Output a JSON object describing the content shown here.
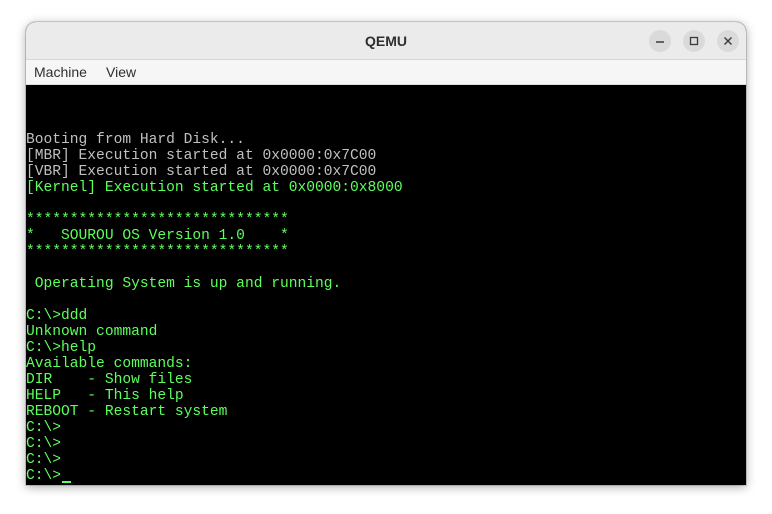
{
  "window": {
    "title": "QEMU"
  },
  "menubar": {
    "items": [
      {
        "label": "Machine"
      },
      {
        "label": "View"
      }
    ]
  },
  "colors": {
    "gray": "#c0c0c0",
    "green": "#5cff5c",
    "background": "#000000"
  },
  "console": {
    "lines": [
      {
        "text": "Booting from Hard Disk...",
        "color": "gray",
        "row": 0
      },
      {
        "text": "[MBR] Execution started at 0x0000:0x7C00",
        "color": "gray",
        "row": 1
      },
      {
        "text": "[VBR] Execution started at 0x0000:0x7C00",
        "color": "gray",
        "row": 2
      },
      {
        "text": "[Kernel] Execution started at 0x0000:0x8000",
        "color": "green",
        "row": 3
      },
      {
        "text": "******************************",
        "color": "green",
        "row": 5
      },
      {
        "text": "*   SOUROU OS Version 1.0    *",
        "color": "green",
        "row": 6
      },
      {
        "text": "******************************",
        "color": "green",
        "row": 7
      },
      {
        "text": " Operating System is up and running.",
        "color": "green",
        "row": 9
      },
      {
        "text": "C:\\>ddd",
        "color": "green",
        "row": 11
      },
      {
        "text": "Unknown command",
        "color": "green",
        "row": 12
      },
      {
        "text": "C:\\>help",
        "color": "green",
        "row": 13
      },
      {
        "text": "Available commands:",
        "color": "green",
        "row": 14
      },
      {
        "text": "DIR    - Show files",
        "color": "green",
        "row": 15
      },
      {
        "text": "HELP   - This help",
        "color": "green",
        "row": 16
      },
      {
        "text": "REBOOT - Restart system",
        "color": "green",
        "row": 17
      },
      {
        "text": "C:\\>",
        "color": "green",
        "row": 18
      },
      {
        "text": "C:\\>",
        "color": "green",
        "row": 19
      },
      {
        "text": "C:\\>",
        "color": "green",
        "row": 20
      },
      {
        "text": "C:\\>",
        "color": "green",
        "row": 21
      }
    ],
    "cursor": {
      "row": 21,
      "col": 4,
      "color": "green"
    }
  }
}
